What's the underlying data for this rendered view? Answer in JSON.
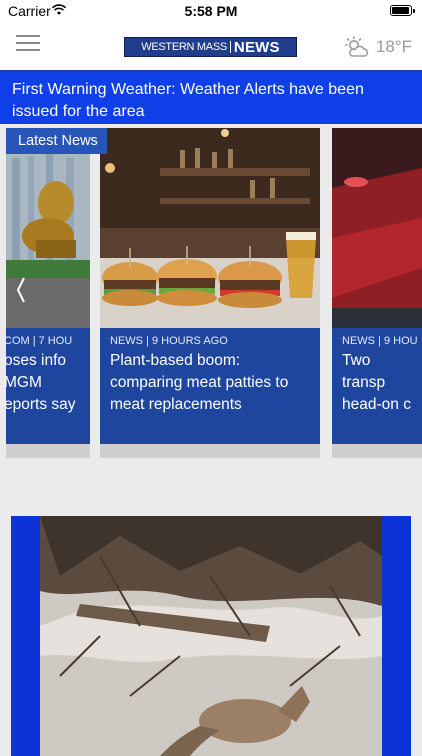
{
  "status_bar": {
    "carrier": "Carrier",
    "time": "5:58 PM"
  },
  "header": {
    "logo_left": "WESTERN MASS",
    "logo_right": "NEWS",
    "temperature": "18°F"
  },
  "alert": {
    "text": "First Warning Weather: Weather Alerts have been issued for the area"
  },
  "latest_news": {
    "tag": "Latest News",
    "cards": [
      {
        "category": "COM | 7 HOU",
        "headline": "oses info\nMGM\neports say"
      },
      {
        "category": "NEWS | 9 HOURS AGO",
        "headline": "Plant-based boom: comparing meat patties to meat replacements"
      },
      {
        "category": "NEWS | 9 HOU",
        "headline": "Two transp\nhead-on c"
      }
    ]
  }
}
